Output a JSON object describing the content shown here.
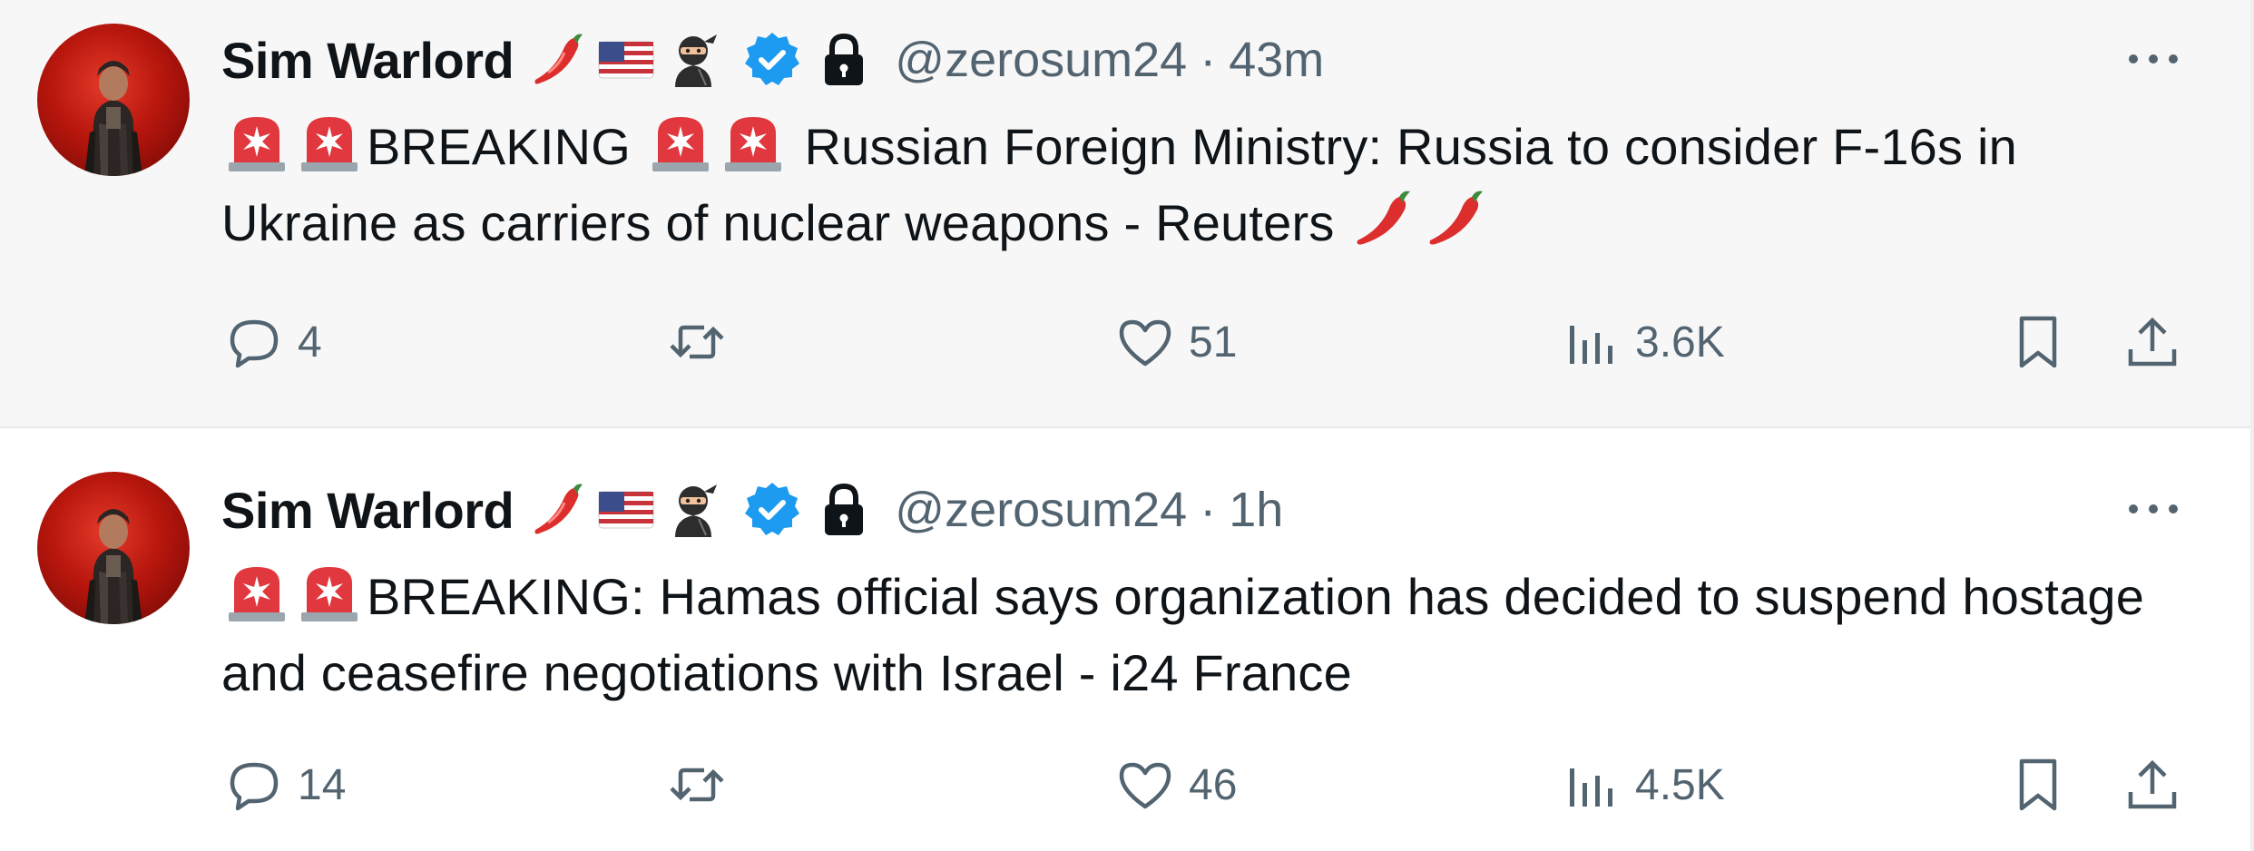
{
  "tweets": [
    {
      "author_name": "Sim Warlord",
      "name_emojis": [
        "chili-pepper",
        "us-flag",
        "ninja"
      ],
      "handle": "@zerosum24",
      "separator": "·",
      "time": "43m",
      "text_segments": [
        "BREAKING",
        " Russian Foreign Ministry: Russia to consider F-16s in Ukraine as carriers of nuclear weapons - Reuters "
      ],
      "reply_count": "4",
      "retweet_count": "",
      "like_count": "51",
      "view_count": "3.6K"
    },
    {
      "author_name": "Sim Warlord",
      "name_emojis": [
        "chili-pepper",
        "us-flag",
        "ninja"
      ],
      "handle": "@zerosum24",
      "separator": "·",
      "time": "1h",
      "text_segments": [
        "BREAKING: Hamas official says organization has decided to suspend hostage and ceasefire negotiations with Israel - i24 France"
      ],
      "reply_count": "14",
      "retweet_count": "",
      "like_count": "46",
      "view_count": "4.5K"
    }
  ],
  "colors": {
    "text_primary": "#0f1419",
    "text_secondary": "#536471",
    "verified_blue": "#1d9bf0",
    "hover_background": "#f7f7f7"
  },
  "icons": {
    "reply": "speech-bubble-icon",
    "retweet": "retweet-arrows-icon",
    "like": "heart-icon",
    "views": "bar-chart-icon",
    "bookmark": "bookmark-icon",
    "share": "share-upload-icon",
    "more": "ellipsis-icon",
    "verified": "verified-badge-icon",
    "lock": "lock-icon",
    "siren": "rotating-light-emoji"
  }
}
